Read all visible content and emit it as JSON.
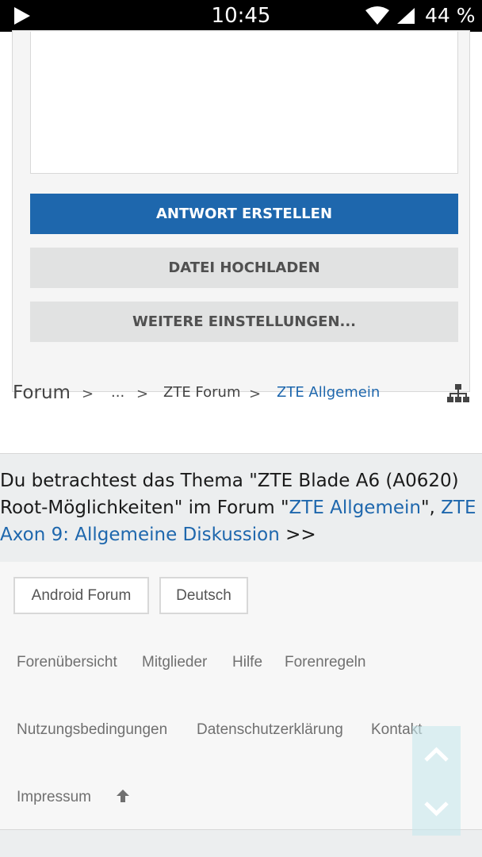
{
  "status_bar": {
    "time": "10:45",
    "battery": "44 %",
    "icons": [
      "play-icon",
      "wifi-icon",
      "signal-icon"
    ]
  },
  "reply_form": {
    "submit_label": "ANTWORT ERSTELLEN",
    "upload_label": "DATEI HOCHLADEN",
    "more_label": "WEITERE EINSTELLUNGEN..."
  },
  "breadcrumb": {
    "items": [
      "Forum",
      "...",
      "ZTE Forum",
      "ZTE Allgemein"
    ],
    "separator": ">",
    "sitemap_icon": "sitemap-icon"
  },
  "info": {
    "prefix": "Du betrachtest das Thema \"ZTE Blade A6 (A0620) Root-Möglichkeiten\" im Forum \"",
    "forum_link": "ZTE Allgemein",
    "middle": "\", ",
    "next_link": "ZTE Axon 9: Allgemeine Diskussion",
    "suffix": " >>"
  },
  "footer": {
    "chips": [
      "Android Forum",
      "Deutsch"
    ],
    "links": [
      "Forenübersicht",
      "Mitglieder",
      "Hilfe",
      "Forenregeln",
      "Nutzungsbedingungen",
      "Datenschutzerklärung",
      "Kontakt",
      "Impressum"
    ]
  },
  "colors": {
    "accent": "#1e67ad",
    "button_secondary": "#e1e2e2",
    "scroll_widget": "#c8e8ec"
  }
}
